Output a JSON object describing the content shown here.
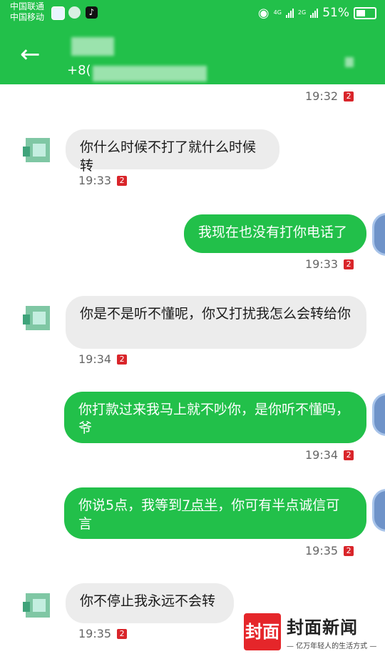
{
  "status_bar": {
    "carrier1": "中国联通",
    "carrier2": "中国移动",
    "net1": "4G",
    "net2": "2G",
    "battery": "51%"
  },
  "header": {
    "back_icon": "←",
    "phone_prefix": "+8("
  },
  "messages": [
    {
      "side": "out",
      "text": "",
      "time": "19:32",
      "badge": "2"
    },
    {
      "side": "in",
      "text": "你什么时候不打了就什么时候转",
      "time": "19:33",
      "badge": "2"
    },
    {
      "side": "out",
      "text": "我现在也没有打你电话了",
      "time": "19:33",
      "badge": "2"
    },
    {
      "side": "in",
      "text": "你是不是听不懂呢，你又打扰我怎么会转给你",
      "time": "19:34",
      "badge": "2"
    },
    {
      "side": "out",
      "text": "你打款过来我马上就不吵你，是你听不懂吗，爷",
      "time": "19:34",
      "badge": "2"
    },
    {
      "side": "out",
      "text_before": "你说5点，我等到",
      "text_link": "7点半",
      "text_after": "，你可有半点诚信可言",
      "time": "19:35",
      "badge": "2"
    },
    {
      "side": "in",
      "text": "你不停止我永远不会转",
      "time": "19:35",
      "badge": "2"
    }
  ],
  "watermark": {
    "logo": "封面",
    "title": "封面新闻",
    "subtitle": "— 亿万年轻人的生活方式 —"
  },
  "colors": {
    "green": "#22c04a",
    "incoming": "#ececec",
    "badge": "#d9252a"
  }
}
